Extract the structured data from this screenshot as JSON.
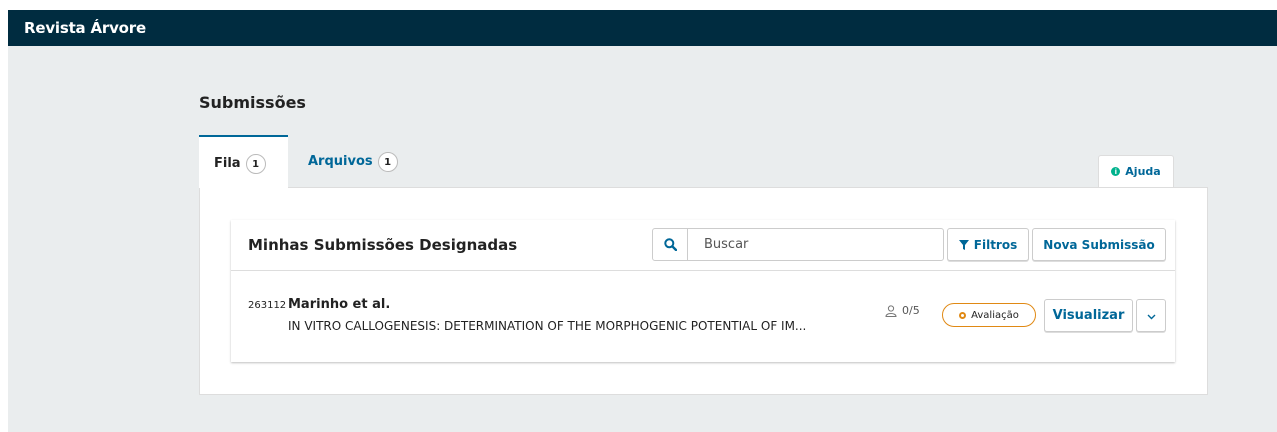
{
  "header": {
    "site_title": "Revista Árvore"
  },
  "page": {
    "title": "Submissões"
  },
  "tabs": [
    {
      "label": "Fila",
      "count": "1",
      "active": true
    },
    {
      "label": "Arquivos",
      "count": "1",
      "active": false
    }
  ],
  "help": {
    "label": "Ajuda",
    "icon": "info-icon"
  },
  "list": {
    "title": "Minhas Submissões Designadas",
    "search_placeholder": "Buscar",
    "filters_label": "Filtros",
    "new_submission_label": "Nova Submissão"
  },
  "submissions": [
    {
      "id": "263112",
      "authors": "Marinho et al.",
      "title": "IN VITRO CALLOGENESIS: DETERMINATION OF THE MORPHOGENIC POTENTIAL OF IM...",
      "reviews": "0/5",
      "stage": "Avaliação",
      "view_label": "Visualizar"
    }
  ],
  "colors": {
    "header_bg": "#002c40",
    "accent": "#006798",
    "stage_review": "#e08914",
    "help_dot": "#00b28d",
    "page_bg": "#eaedee"
  }
}
